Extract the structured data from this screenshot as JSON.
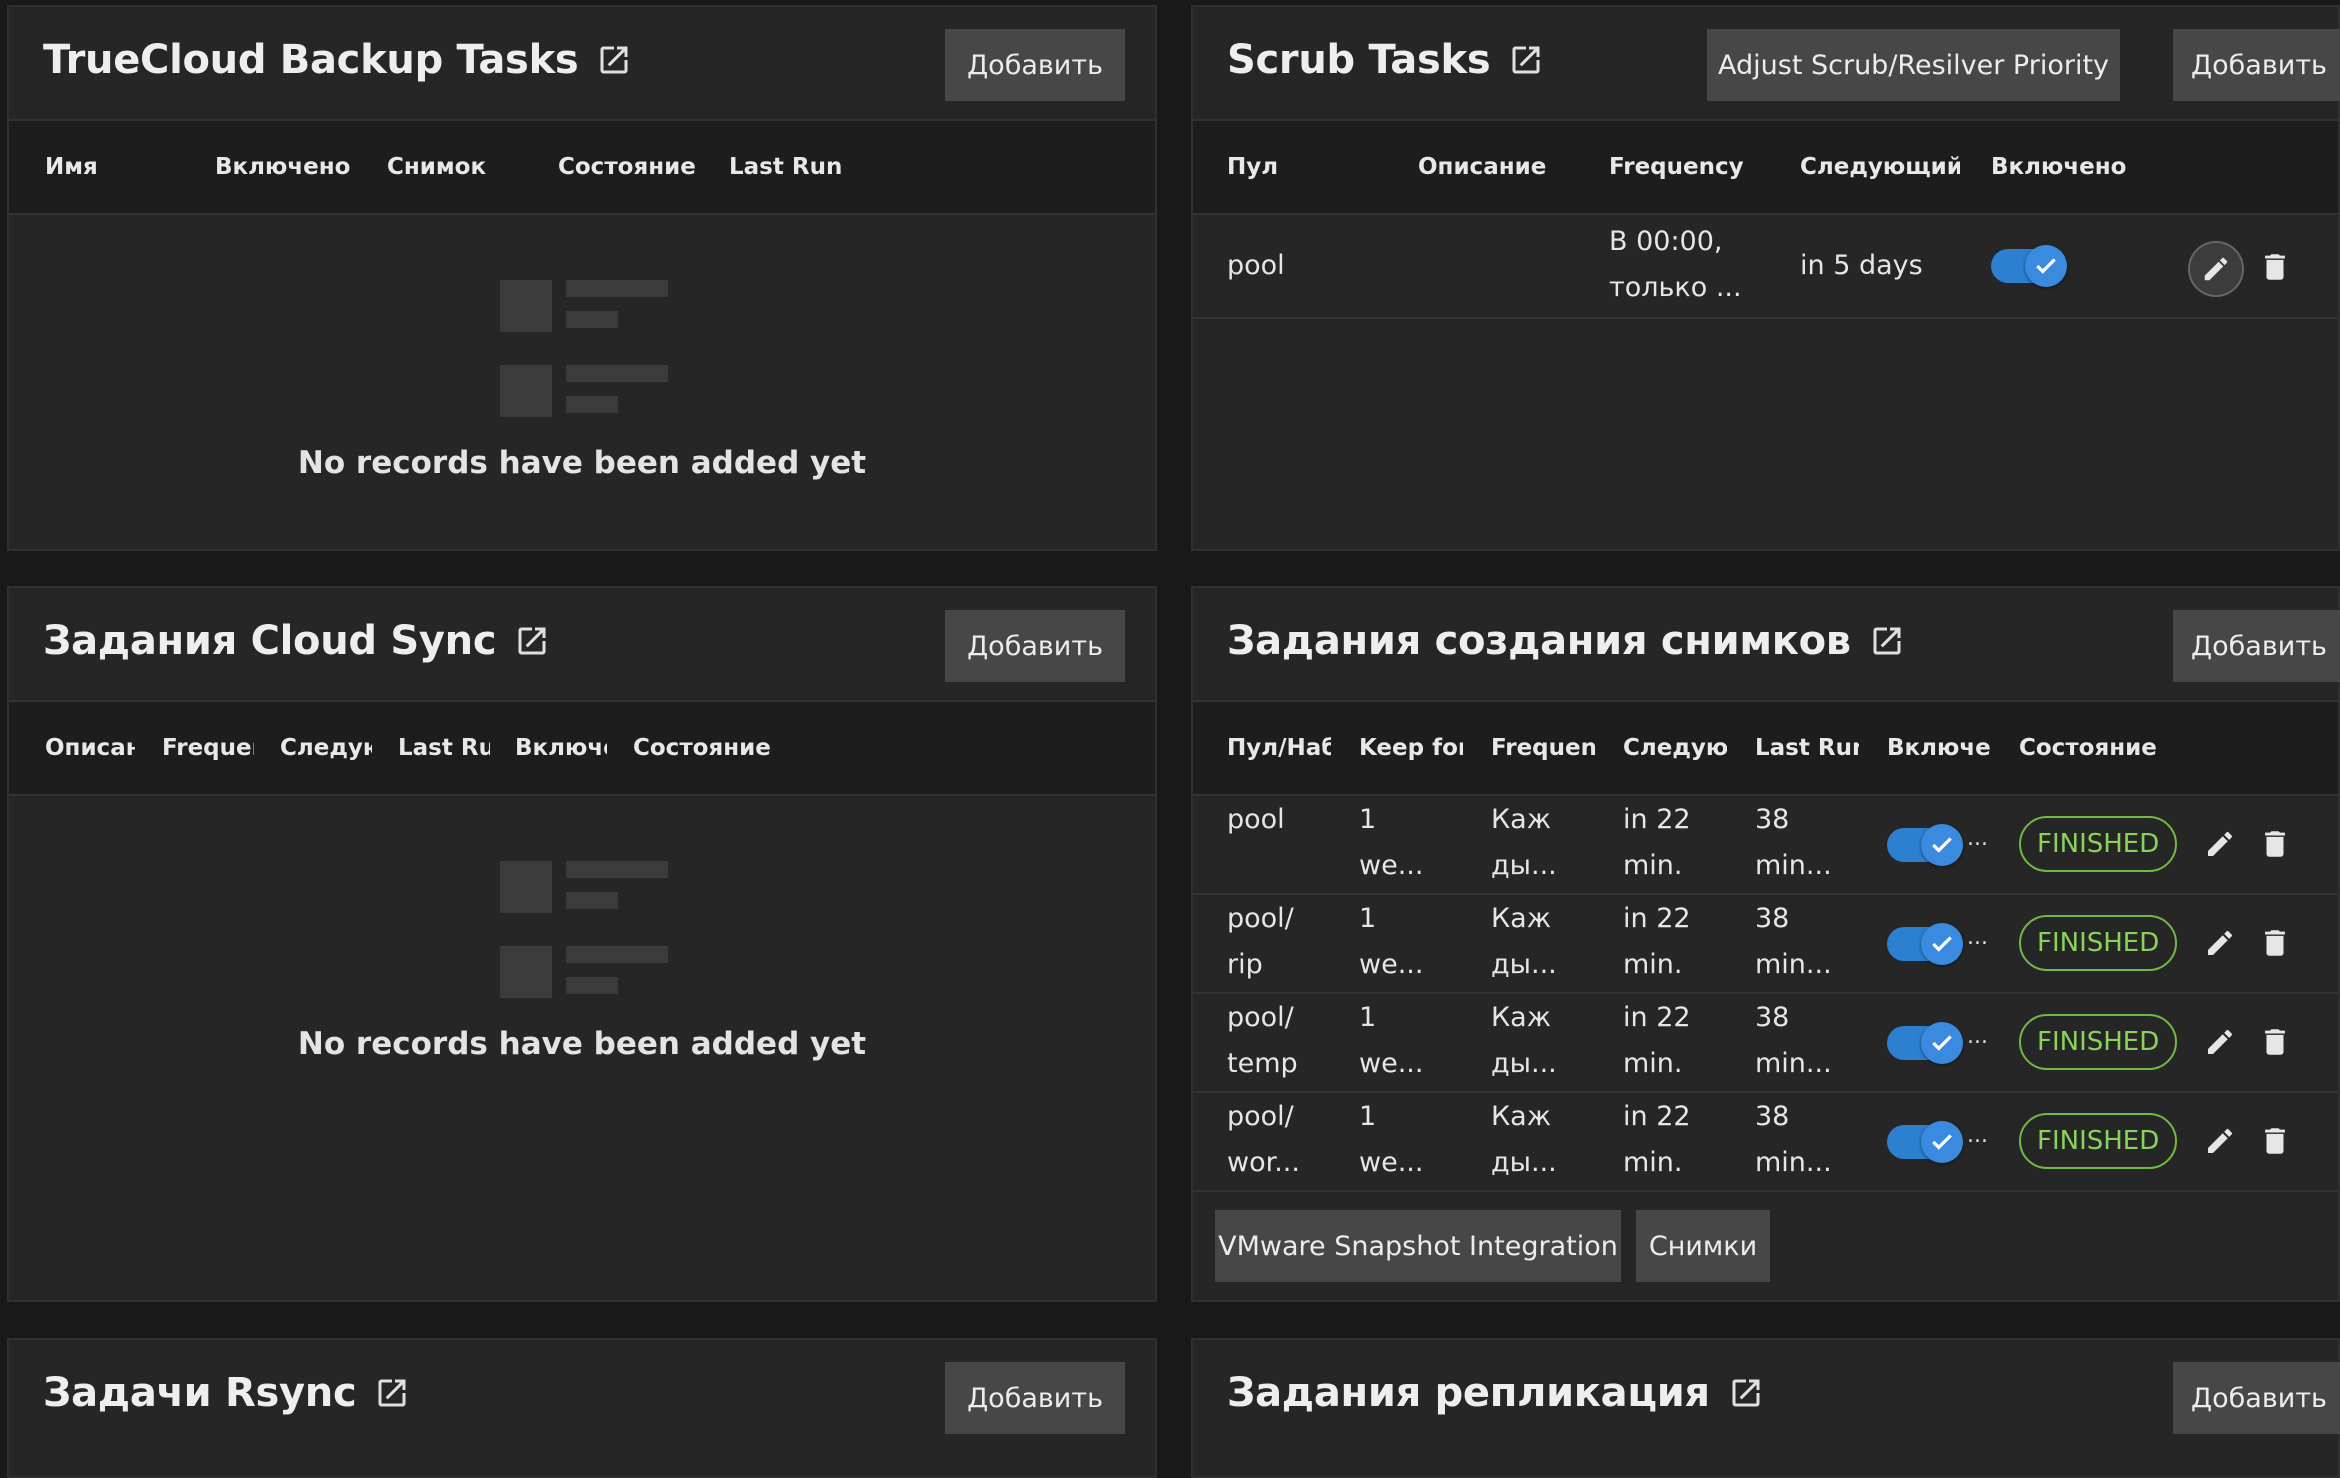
{
  "common": {
    "add_label": "Добавить",
    "empty_text": "No records have been added yet"
  },
  "truecloud": {
    "title": "TrueCloud Backup Tasks",
    "columns": [
      "Имя",
      "Включено",
      "Снимок",
      "Состояние",
      "Last Run"
    ]
  },
  "scrub": {
    "title": "Scrub Tasks",
    "priority_label": "Adjust Scrub/Resilver Priority",
    "columns": [
      "Пул",
      "Описание",
      "Frequency",
      "Следующий за",
      "Включено"
    ],
    "rows": [
      {
        "pool": "pool",
        "description": "",
        "frequency_line1": "В 00:00,",
        "frequency_line2": "только ...",
        "next": "in 5 days",
        "enabled": true
      }
    ]
  },
  "cloudsync": {
    "title": "Задания Cloud Sync",
    "columns": [
      "Описание",
      "Frequency",
      "Следующий",
      "Last Run",
      "Включено",
      "Состояние"
    ]
  },
  "snapshots": {
    "title": "Задания создания снимков",
    "columns": [
      "Пул/Набор",
      "Keep for",
      "Frequency",
      "Следующий",
      "Last Run",
      "Включено",
      "Состояние"
    ],
    "rows": [
      {
        "pool_l1": "pool",
        "pool_l2": "",
        "keep_l1": "1",
        "keep_l2": "we...",
        "freq_l1": "Каж",
        "freq_l2": "ды...",
        "next_l1": "in 22",
        "next_l2": "min.",
        "last_l1": "38",
        "last_l2": "min...",
        "enabled_more": "...",
        "status": "FINISHED"
      },
      {
        "pool_l1": "pool/",
        "pool_l2": "rip",
        "keep_l1": "1",
        "keep_l2": "we...",
        "freq_l1": "Каж",
        "freq_l2": "ды...",
        "next_l1": "in 22",
        "next_l2": "min.",
        "last_l1": "38",
        "last_l2": "min...",
        "enabled_more": "...",
        "status": "FINISHED"
      },
      {
        "pool_l1": "pool/",
        "pool_l2": "temp",
        "keep_l1": "1",
        "keep_l2": "we...",
        "freq_l1": "Каж",
        "freq_l2": "ды...",
        "next_l1": "in 22",
        "next_l2": "min.",
        "last_l1": "38",
        "last_l2": "min...",
        "enabled_more": "...",
        "status": "FINISHED"
      },
      {
        "pool_l1": "pool/",
        "pool_l2": "wor...",
        "keep_l1": "1",
        "keep_l2": "we...",
        "freq_l1": "Каж",
        "freq_l2": "ды...",
        "next_l1": "in 22",
        "next_l2": "min.",
        "last_l1": "38",
        "last_l2": "min...",
        "enabled_more": "...",
        "status": "FINISHED"
      }
    ],
    "vmware_label": "VMware Snapshot Integration",
    "snapshots_label": "Снимки"
  },
  "rsync": {
    "title": "Задачи Rsync"
  },
  "replication": {
    "title": "Задания репликация"
  },
  "colors": {
    "accent_toggle": "#2d7fd0",
    "finished_green": "#71b944",
    "button_bg": "#474747"
  }
}
